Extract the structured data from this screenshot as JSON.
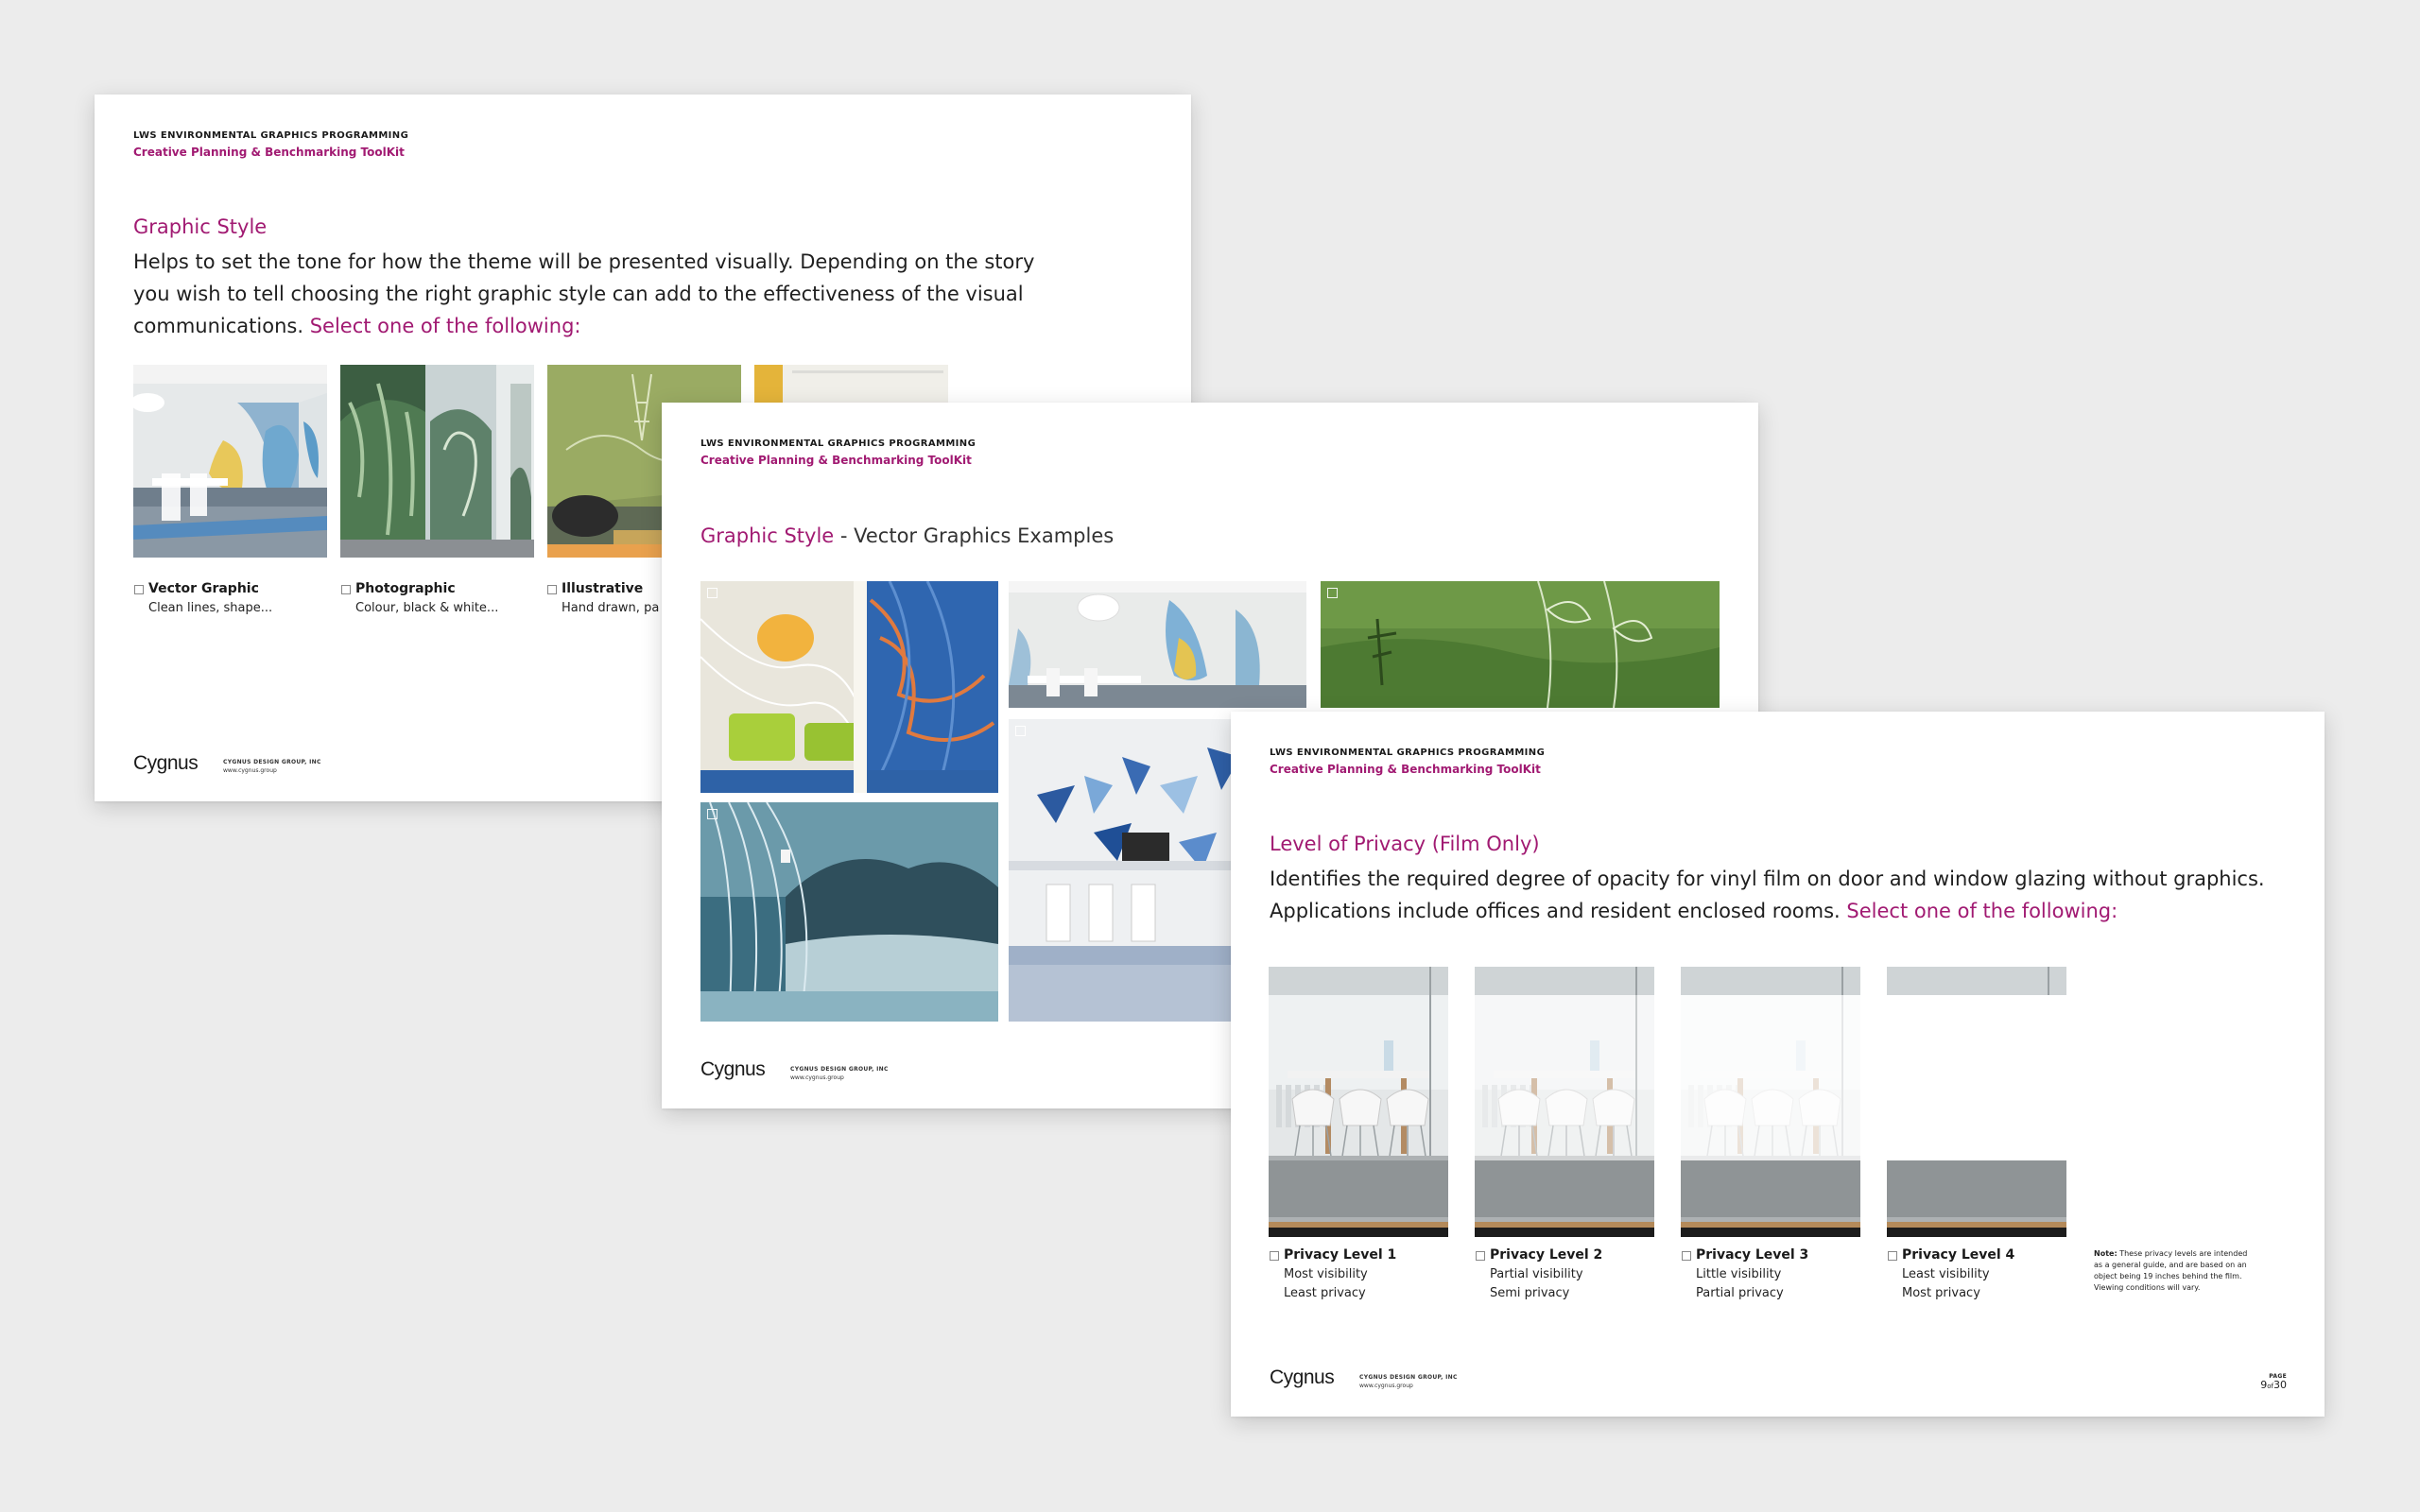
{
  "slides": [
    {
      "header_top": "LWS ENVIRONMENTAL GRAPHICS PROGRAMMING",
      "header_sub": "Creative Planning & Benchmarking ToolKit",
      "title": "Graphic Style",
      "body": "Helps to set the tone for how the theme will be presented visually. Depending on the story you wish to tell choosing the right graphic style can add to the effectiveness of the visual communications.",
      "select_prompt": "Select one of the following:",
      "options": [
        {
          "label": "Vector Graphic",
          "desc": "Clean lines, shape..."
        },
        {
          "label": "Photographic",
          "desc": "Colour, black & white..."
        },
        {
          "label": "Illustrative",
          "desc": "Hand drawn, pa"
        }
      ],
      "logo": "Cygnus",
      "company_name": "CYGNUS DESIGN GROUP, INC",
      "company_url": "www.cygnus.group"
    },
    {
      "header_top": "LWS ENVIRONMENTAL GRAPHICS PROGRAMMING",
      "header_sub": "Creative Planning & Benchmarking ToolKit",
      "title": "Graphic Style",
      "title_rest": " - Vector Graphics Examples",
      "logo": "Cygnus",
      "company_name": "CYGNUS DESIGN GROUP, INC",
      "company_url": "www.cygnus.group"
    },
    {
      "header_top": "LWS ENVIRONMENTAL GRAPHICS PROGRAMMING",
      "header_sub": "Creative Planning & Benchmarking ToolKit",
      "title": "Level of Privacy (Film Only)",
      "body": "Identifies the required degree of opacity for vinyl film on door and window glazing without graphics. Applications include offices and resident enclosed rooms.",
      "select_prompt": "Select one of the following:",
      "privacy_levels": [
        {
          "label": "Privacy Level 1",
          "desc1": "Most visibility",
          "desc2": "Least privacy",
          "opacity": 0.0
        },
        {
          "label": "Privacy Level 2",
          "desc1": "Partial visibility",
          "desc2": "Semi privacy",
          "opacity": 0.45
        },
        {
          "label": "Privacy Level 3",
          "desc1": "Little visibility",
          "desc2": "Partial privacy",
          "opacity": 0.75
        },
        {
          "label": "Privacy Level 4",
          "desc1": "Least visibility",
          "desc2": "Most privacy",
          "opacity": 1.0
        }
      ],
      "note_label": "Note:",
      "note_text": "These privacy levels are intended as a general guide, and are based on an object being 19 inches behind the film. Viewing conditions will vary.",
      "page_label": "PAGE",
      "page_num": "9",
      "page_of": "of",
      "page_total": "30",
      "logo": "Cygnus",
      "company_name": "CYGNUS DESIGN GROUP, INC",
      "company_url": "www.cygnus.group"
    }
  ],
  "colors": {
    "accent": "#a11a72",
    "background": "#ececec",
    "slide": "#ffffff"
  }
}
